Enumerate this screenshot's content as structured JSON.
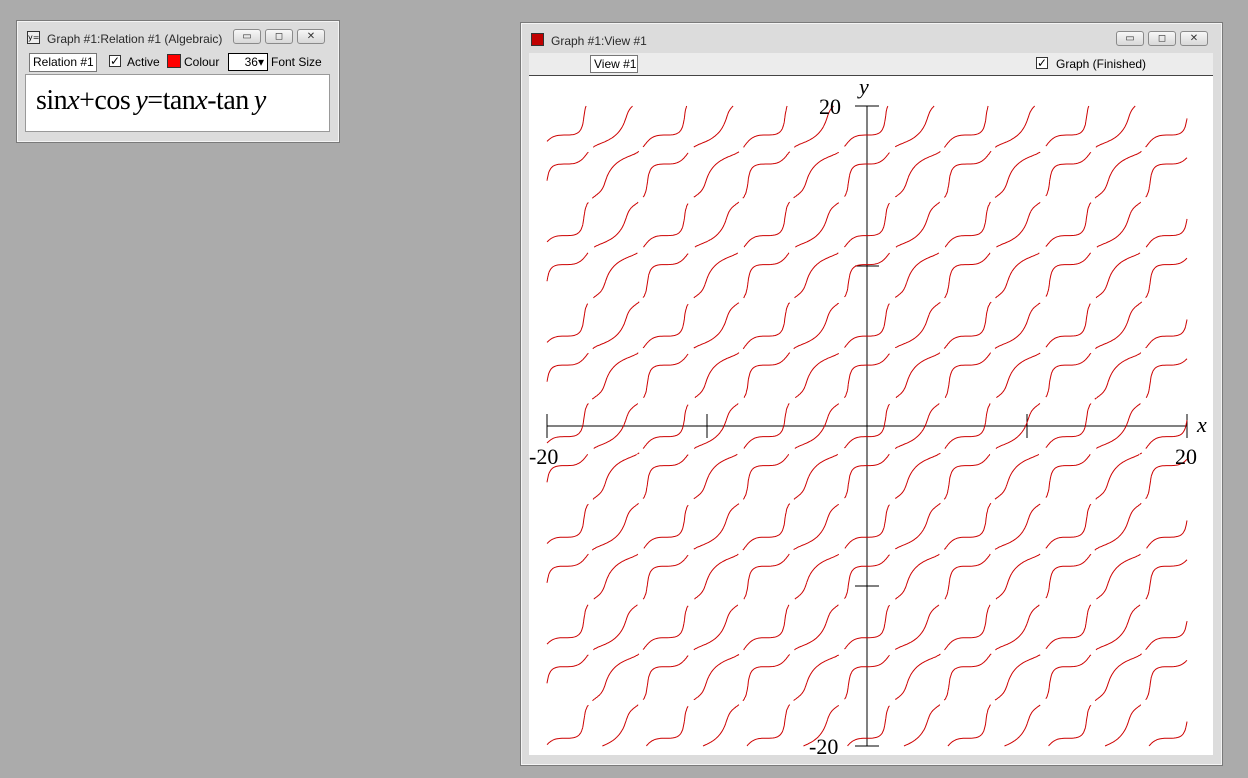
{
  "relation_window": {
    "title": "Graph #1:Relation #1 (Algebraic)",
    "icon": "yx-relation-icon",
    "minimize": "▭",
    "restore": "◻",
    "close": "✕",
    "relation_name": "Relation #1",
    "active_label": "Active",
    "active_checked": true,
    "colour_label": "Colour",
    "colour_value": "#ff0000",
    "font_size_value": "36",
    "font_size_label": "Font Size",
    "equation": {
      "part1": "sin",
      "var1": "x",
      "part2": "+cos",
      "var2": "y",
      "part3": "=tan",
      "var3": "x",
      "part4": "-tan",
      "var4": "y"
    }
  },
  "view_window": {
    "title": "Graph #1:View #1",
    "icon": "graph-view-icon",
    "minimize": "▭",
    "restore": "◻",
    "close": "✕",
    "view_name": "View #1",
    "status_checked": true,
    "status_label": "Graph (Finished)"
  },
  "chart_data": {
    "type": "line",
    "relation": "sin x + cos y = tan x - tan y",
    "xlabel": "x",
    "ylabel": "y",
    "xlim": [
      -20,
      20
    ],
    "ylim": [
      -20,
      20
    ],
    "x_tick_labels": [
      "-20",
      "20"
    ],
    "y_tick_labels": [
      "20",
      "-20"
    ],
    "x_ticks": [
      -20,
      -10,
      10,
      20
    ],
    "y_ticks": [
      -20,
      -10,
      10,
      20
    ],
    "curve_color": "#cc0000",
    "grid": false
  }
}
